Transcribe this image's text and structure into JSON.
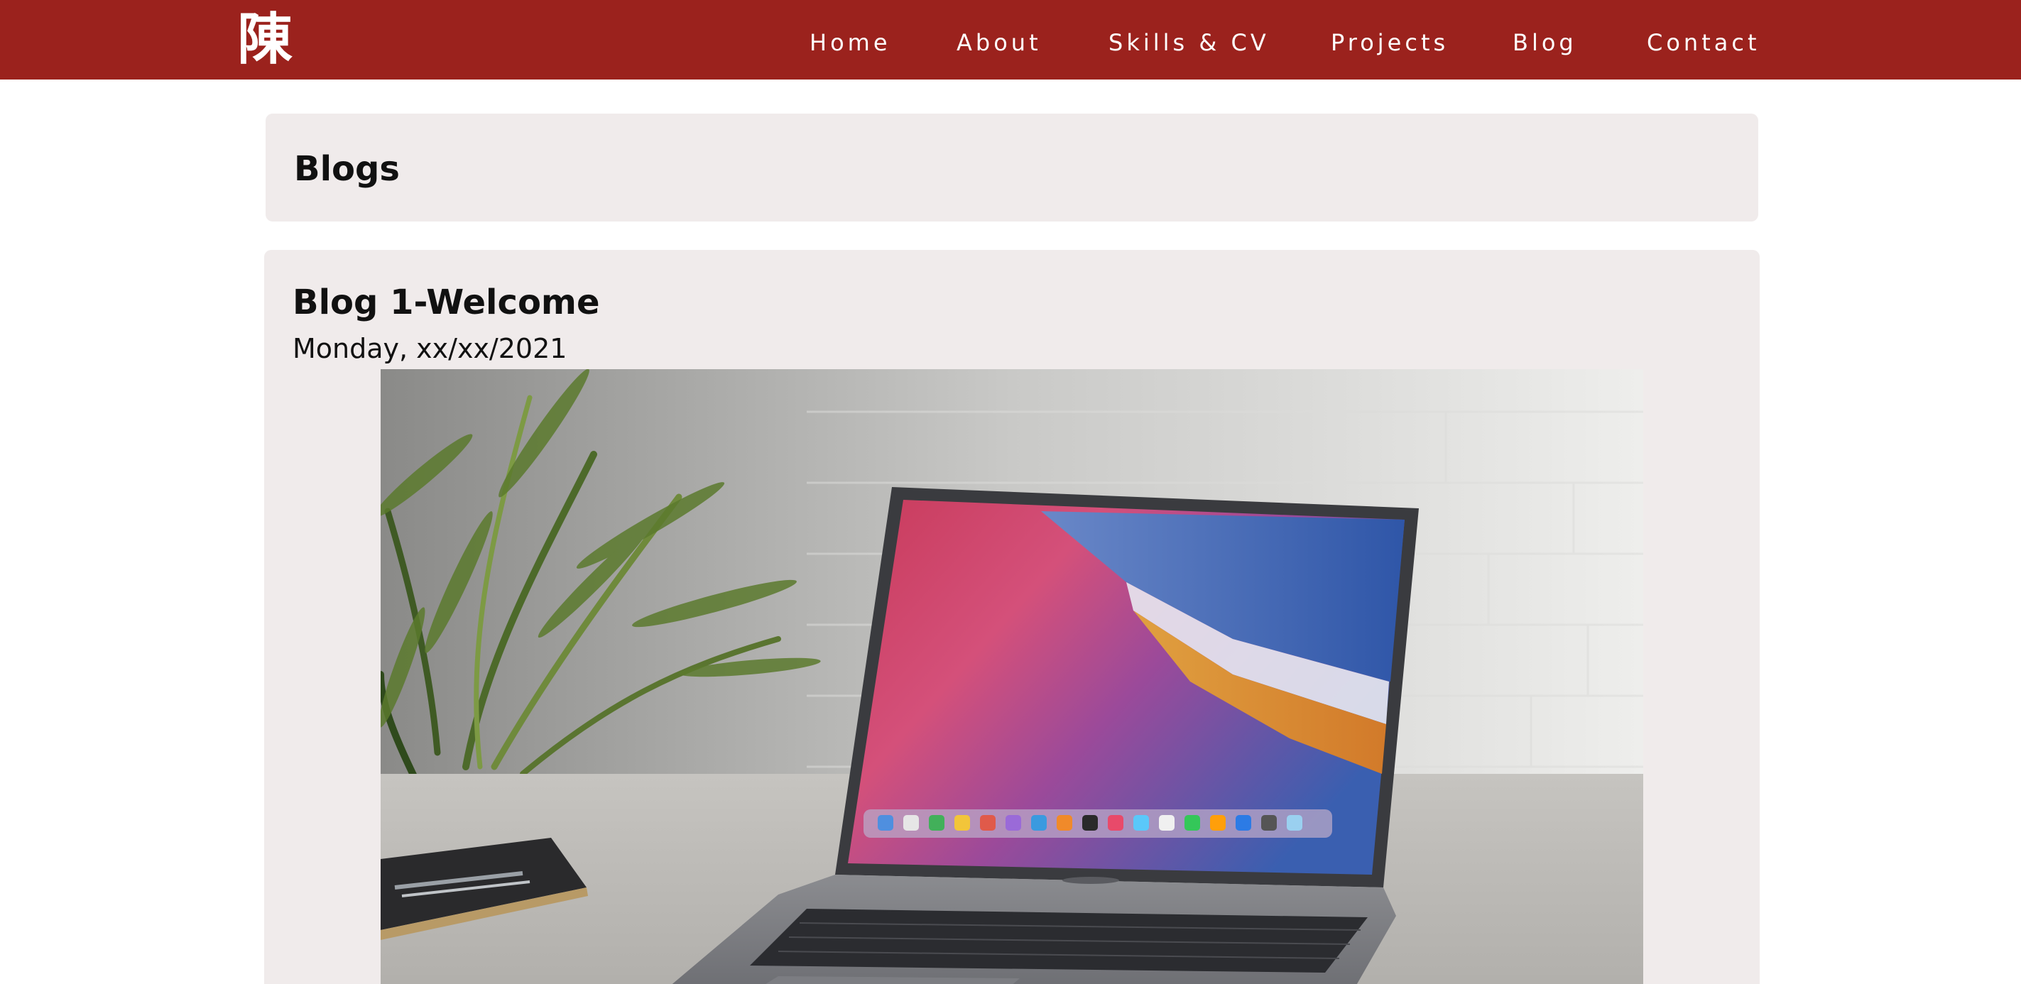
{
  "header": {
    "logo_text": "陳",
    "nav": [
      {
        "label": "Home"
      },
      {
        "label": "About"
      },
      {
        "label": "Skills & CV"
      },
      {
        "label": "Projects"
      },
      {
        "label": "Blog"
      },
      {
        "label": "Contact"
      }
    ],
    "colors": {
      "bar": "#9b221d",
      "text": "#ffffff"
    }
  },
  "main": {
    "section_title": "Blogs",
    "posts": [
      {
        "title": "Blog 1-Welcome",
        "date": "Monday, xx/xx/2021",
        "image": "laptop-on-desk-photo"
      }
    ],
    "colors": {
      "panel": "#f0ebeb"
    }
  }
}
